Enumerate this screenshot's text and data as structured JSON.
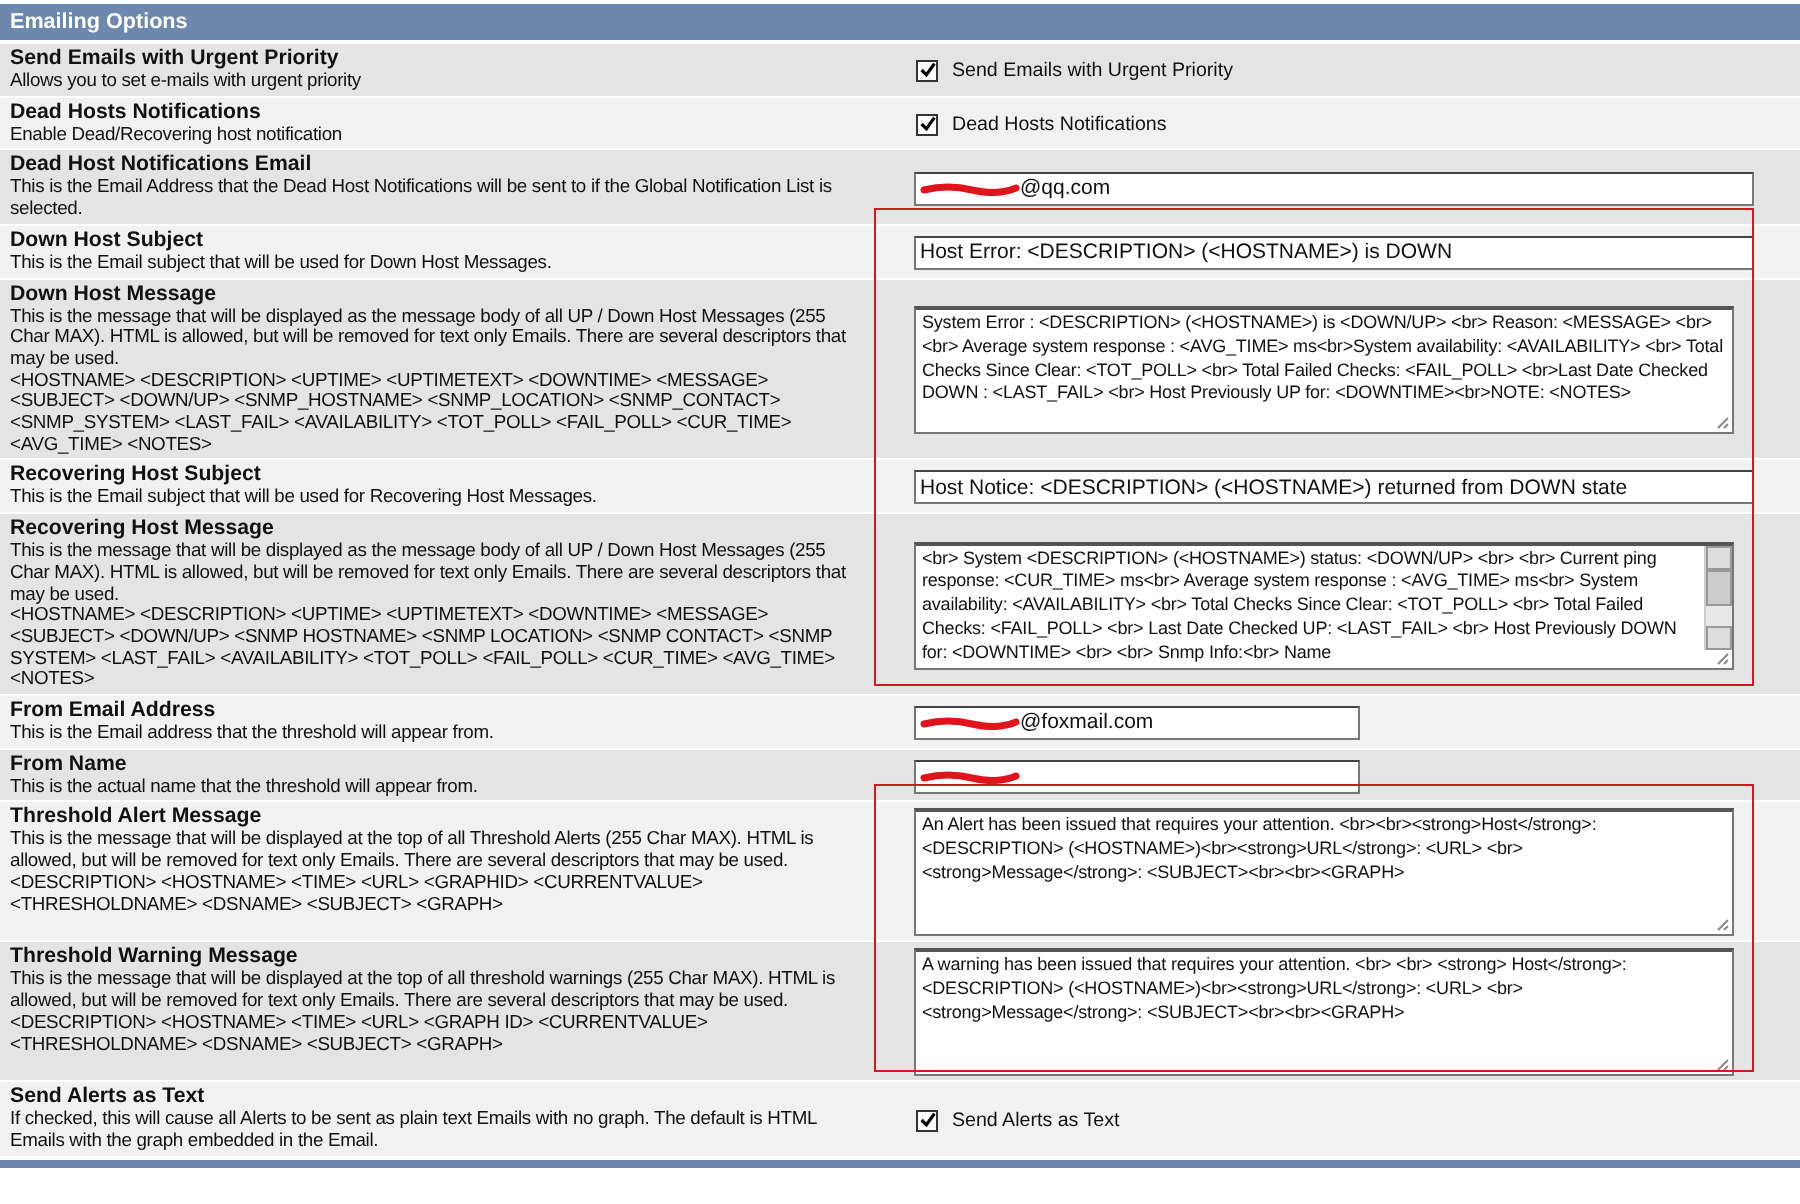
{
  "section": {
    "title": "Emailing Options"
  },
  "rows": [
    {
      "kind": "checkbox",
      "title": "Send Emails with Urgent Priority",
      "description": "Allows you to set e-mails with urgent priority",
      "checked": true,
      "label": "Send Emails with Urgent Priority"
    },
    {
      "kind": "checkbox",
      "title": "Dead Hosts Notifications",
      "description": "Enable Dead/Recovering host notification",
      "checked": true,
      "label": "Dead Hosts Notifications"
    },
    {
      "kind": "wide-input",
      "title": "Dead Host Notifications Email",
      "description": "This is the Email Address that the Dead Host Notifications will be sent to if the Global Notification List is selected.",
      "value": "@qq.com",
      "redacted": true
    },
    {
      "kind": "wide-input",
      "title": "Down Host Subject",
      "description": "This is the Email subject that will be used for Down Host Messages.",
      "value": "Host Error: <DESCRIPTION> (<HOSTNAME>) is DOWN",
      "framed": true
    },
    {
      "kind": "textarea",
      "title": "Down Host Message",
      "description": "This is the message that will be displayed as the message body of all UP / Down Host Messages (255 Char MAX). HTML is allowed, but will be removed for text only Emails. There are several descriptors that may be used.",
      "descriptors": "<HOSTNAME> <DESCRIPTION> <UPTIME> <UPTIMETEXT> <DOWNTIME> <MESSAGE> <SUBJECT> <DOWN/UP> <SNMP_HOSTNAME> <SNMP_LOCATION> <SNMP_CONTACT> <SNMP_SYSTEM> <LAST_FAIL> <AVAILABILITY> <TOT_POLL> <FAIL_POLL> <CUR_TIME> <AVG_TIME> <NOTES>",
      "value": "System Error : <DESCRIPTION> (<HOSTNAME>) is <DOWN/UP> <br> Reason: <MESSAGE> <br> <br> Average system response : <AVG_TIME> ms<br>System availability: <AVAILABILITY> <br> Total Checks Since Clear: <TOT_POLL> <br> Total Failed Checks: <FAIL_POLL> <br>Last Date Checked DOWN : <LAST_FAIL> <br> Host Previously UP for: <DOWNTIME><br>NOTE: <NOTES>",
      "framed": true
    },
    {
      "kind": "wide-input",
      "title": "Recovering Host Subject",
      "description": "This is the Email subject that will be used for Recovering Host Messages.",
      "value": "Host Notice: <DESCRIPTION> (<HOSTNAME>) returned from DOWN state",
      "framed": true
    },
    {
      "kind": "textarea",
      "title": "Recovering Host Message",
      "description": "This is the message that will be displayed as the message body of all UP / Down Host Messages (255 Char MAX). HTML is allowed, but will be removed for text only Emails. There are several descriptors that may be used.",
      "descriptors": "<HOSTNAME> <DESCRIPTION> <UPTIME> <UPTIMETEXT> <DOWNTIME> <MESSAGE> <SUBJECT> <DOWN/UP> <SNMP HOSTNAME> <SNMP LOCATION> <SNMP CONTACT> <SNMP SYSTEM> <LAST_FAIL> <AVAILABILITY> <TOT_POLL> <FAIL_POLL> <CUR_TIME> <AVG_TIME> <NOTES>",
      "value": "<br> System <DESCRIPTION> (<HOSTNAME>) status: <DOWN/UP> <br> <br> Current ping response: <CUR_TIME> ms<br> Average system response : <AVG_TIME> ms<br> System availability: <AVAILABILITY> <br> Total Checks Since Clear: <TOT_POLL> <br> Total Failed Checks: <FAIL_POLL> <br> Last Date Checked UP: <LAST_FAIL> <br> Host Previously DOWN for: <DOWNTIME> <br> <br> Snmp Info:<br> Name",
      "scrollbar": true,
      "framed": true
    },
    {
      "kind": "short-input",
      "title": "From Email Address",
      "description": "This is the Email address that the threshold will appear from.",
      "value": "@foxmail.com",
      "redacted": true
    },
    {
      "kind": "short-input",
      "title": "From Name",
      "description": "This is the actual name that the threshold will appear from.",
      "redacted": true
    },
    {
      "kind": "textarea",
      "title": "Threshold Alert Message",
      "description": "This is the message that will be displayed at the top of all Threshold Alerts (255 Char MAX). HTML is allowed, but will be removed for text only Emails. There are several descriptors that may be used.",
      "descriptors": "<DESCRIPTION> <HOSTNAME> <TIME> <URL> <GRAPHID> <CURRENTVALUE> <THRESHOLDNAME> <DSNAME> <SUBJECT> <GRAPH>",
      "value": "An Alert has been issued that requires your attention. <br><br><strong>Host</strong>: <DESCRIPTION> (<HOSTNAME>)<br><strong>URL</strong>: <URL> <br> <strong>Message</strong>: <SUBJECT><br><br><GRAPH>",
      "framed": true
    },
    {
      "kind": "textarea",
      "title": "Threshold Warning Message",
      "description": "This is the message that will be displayed at the top of all threshold warnings (255 Char MAX). HTML is allowed, but will be removed for text only Emails. There are several descriptors that may be used.",
      "descriptors": "<DESCRIPTION> <HOSTNAME> <TIME> <URL> <GRAPH ID> <CURRENTVALUE> <THRESHOLDNAME> <DSNAME> <SUBJECT> <GRAPH>",
      "value": "A warning has been issued that requires your attention. <br> <br> <strong> Host</strong>: <DESCRIPTION> (<HOSTNAME>)<br><strong>URL</strong>: <URL> <br> <strong>Message</strong>: <SUBJECT><br><br><GRAPH>",
      "framed": true
    },
    {
      "kind": "checkbox",
      "title": "Send Alerts as Text",
      "description": "If checked, this will cause all Alerts to be sent as plain text Emails with no graph. The default is HTML Emails with the graph embedded in the Email.",
      "checked": true,
      "label": "Send Alerts as Text"
    }
  ]
}
